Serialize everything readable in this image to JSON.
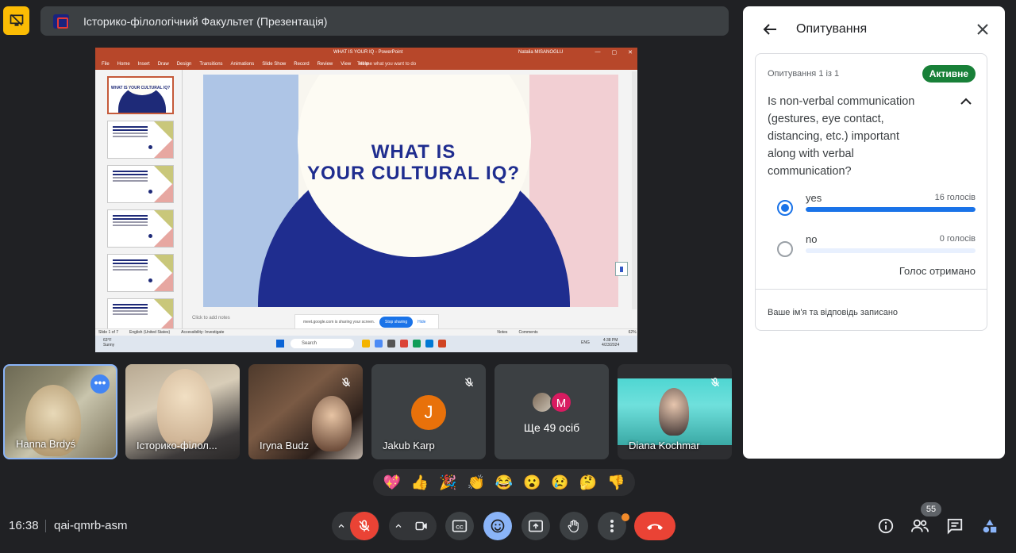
{
  "meeting": {
    "title": "Історико-філологічний Факультет (Презентація)",
    "time": "16:38",
    "code": "qai-qmrb-asm",
    "participant_count": "55"
  },
  "shared_screen": {
    "doc_title": "WHAT IS YOUR IQ - PowerPoint",
    "user_name": "Natalia MISANOGLU",
    "menu": [
      "File",
      "Home",
      "Insert",
      "Draw",
      "Design",
      "Transitions",
      "Animations",
      "Slide Show",
      "Record",
      "Review",
      "View",
      "Help"
    ],
    "tell_me": "Tell me what you want to do",
    "thumb_numbers": [
      "1",
      "2",
      "3",
      "4",
      "5",
      "6"
    ],
    "thumb1_text": "WHAT IS YOUR CULTURAL IQ?",
    "slide_heading_line1": "WHAT IS",
    "slide_heading_line2": "YOUR CULTURAL IQ?",
    "notes_placeholder": "Click to add notes",
    "share_message": "meet.google.com is sharing your screen.",
    "stop_sharing": "Stop sharing",
    "hide": "Hide",
    "status_items": [
      "Slide 1 of 7",
      "English (United States)",
      "Accessibility: Investigate",
      "Notes",
      "Comments",
      "62%"
    ],
    "weather_temp": "63°F",
    "weather_desc": "Sunny",
    "search_placeholder": "Search",
    "clock_time": "4:38 PM",
    "clock_date": "4/23/2024",
    "clock_lang": "ENG"
  },
  "participants": [
    {
      "name": "Hanna Brdyś"
    },
    {
      "name": "Історико-філол..."
    },
    {
      "name": "Iryna Budz"
    },
    {
      "name": "Jakub Karp",
      "initial": "J"
    },
    {
      "name": "Ще 49 осіб",
      "initial": "M"
    },
    {
      "name": "Diana Kochmar"
    }
  ],
  "reactions": [
    "💖",
    "👍",
    "🎉",
    "👏",
    "😂",
    "😮",
    "😢",
    "🤔",
    "👎"
  ],
  "panel": {
    "title": "Опитування",
    "counter": "Опитування 1 із 1",
    "status": "Активне",
    "question": "Is non-verbal communication (gestures, eye contact, distancing, etc.) important along with verbal communication?",
    "options": [
      {
        "label": "yes",
        "votes": "16 голосів",
        "fraction": 1.0,
        "selected": true
      },
      {
        "label": "no",
        "votes": "0 голосів",
        "fraction": 0.0,
        "selected": false
      }
    ],
    "received": "Голос отримано",
    "recorded": "Ваше ім'я та відповідь записано"
  },
  "colors": {
    "accent": "#1a73e8",
    "active_badge": "#188038",
    "leave": "#ea4335",
    "present_icon": "#fbbc04"
  }
}
